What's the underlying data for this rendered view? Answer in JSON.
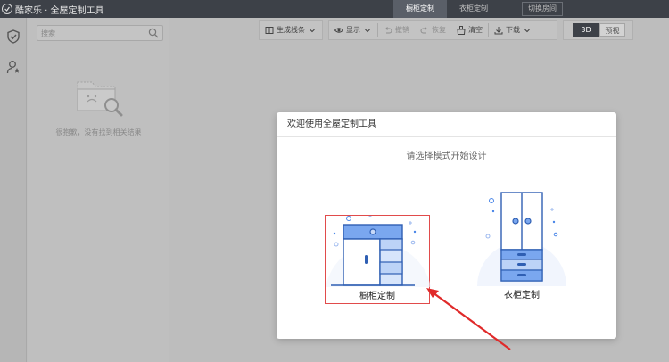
{
  "header": {
    "logo_text": "酷家乐 · 全屋定制工具",
    "tabs": [
      {
        "label": "橱柜定制",
        "active": true
      },
      {
        "label": "衣柜定制",
        "active": false
      }
    ],
    "switch_room_label": "切换房间"
  },
  "rail": {
    "items": [
      {
        "icon": "shield-check-icon"
      },
      {
        "icon": "user-star-icon"
      }
    ]
  },
  "panel": {
    "search_placeholder": "搜索",
    "empty_text": "很抱歉，没有找到相关结果"
  },
  "toolbar": {
    "generate_lines": "生成线条",
    "display": "显示",
    "undo": "撤销",
    "redo": "恢复",
    "clear": "清空",
    "download": "下载",
    "view_3d": "3D",
    "view_preview": "预视"
  },
  "modal": {
    "title": "欢迎使用全屋定制工具",
    "subtitle": "请选择模式开始设计",
    "options": [
      {
        "label": "橱柜定制",
        "selected": true
      },
      {
        "label": "衣柜定制",
        "selected": false
      }
    ]
  },
  "colors": {
    "topbar": "#3d4148",
    "accent_blue": "#4a86e8",
    "selection_red": "#e14b4b"
  }
}
